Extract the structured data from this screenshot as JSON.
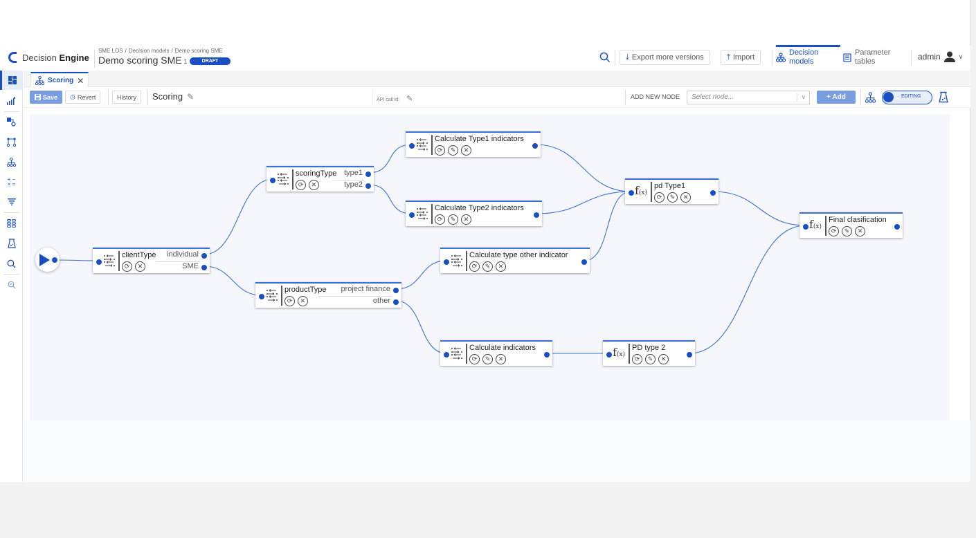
{
  "header": {
    "brand_light": "Decision ",
    "brand_bold": "Engine",
    "breadcrumb": [
      "SME LOS",
      "Decision models",
      "Demo scoring SME"
    ],
    "model_title": "Demo scoring SME",
    "version": "1",
    "status_badge": "DRAFT",
    "export_label": "Export more versions",
    "import_label": "Import",
    "nav": [
      {
        "label_1": "Decision",
        "label_2": "models",
        "active": true
      },
      {
        "label_1": "Parameter",
        "label_2": "tables",
        "active": false
      }
    ],
    "user": "admin"
  },
  "sidebar": {
    "items": [
      "dashboard-icon",
      "analytics-icon",
      "node-link-icon",
      "flow-icon",
      "tree-icon",
      "calculator-icon",
      "filter-icon",
      "grid-icon",
      "flask-icon",
      "search-icon",
      "search-history-icon"
    ]
  },
  "tabs": [
    {
      "label": "Scoring",
      "icon": "tree-icon",
      "active": true
    }
  ],
  "toolbar": {
    "save_label": "Save",
    "revert_label": "Revert",
    "history_label": "History",
    "title": "Scoring",
    "api_label": "API call id:",
    "add_node_label": "ADD NEW NODE",
    "select_placeholder": "Select node...",
    "add_label": "+ Add",
    "toggle_label": "EDITING",
    "toggle_on": true
  },
  "flow": {
    "nodes": [
      {
        "id": "clientType",
        "name": "clientType",
        "type": "switch",
        "branches": [
          "individual",
          "SME"
        ],
        "actions": [
          "refresh",
          "delete"
        ]
      },
      {
        "id": "scoringType",
        "name": "scoringType",
        "type": "switch",
        "branches": [
          "type1",
          "type2"
        ],
        "actions": [
          "refresh",
          "delete"
        ]
      },
      {
        "id": "productType",
        "name": "productType",
        "type": "switch",
        "branches": [
          "project finance",
          "other"
        ],
        "actions": [
          "refresh",
          "delete"
        ]
      },
      {
        "id": "calcType1",
        "name": "Calculate Type1 indicators",
        "type": "switch",
        "branches": [],
        "actions": [
          "refresh",
          "edit",
          "delete"
        ]
      },
      {
        "id": "calcType2",
        "name": "Calculate Type2 indicators",
        "type": "switch",
        "branches": [],
        "actions": [
          "refresh",
          "edit",
          "delete"
        ]
      },
      {
        "id": "calcOther",
        "name": "Calculate type other indicator",
        "type": "switch",
        "branches": [],
        "actions": [
          "refresh",
          "edit",
          "delete"
        ]
      },
      {
        "id": "calcInd",
        "name": "Calculate indicators",
        "type": "switch",
        "branches": [],
        "actions": [
          "refresh",
          "edit",
          "delete"
        ]
      },
      {
        "id": "pdType1",
        "name": "pd Type1",
        "type": "function",
        "branches": [],
        "actions": [
          "refresh",
          "edit",
          "delete"
        ]
      },
      {
        "id": "pdType2",
        "name": "PD type 2",
        "type": "function",
        "branches": [],
        "actions": [
          "refresh",
          "edit",
          "delete"
        ]
      },
      {
        "id": "final",
        "name": "Final clasification",
        "type": "function",
        "branches": [],
        "actions": [
          "refresh",
          "edit",
          "delete"
        ]
      }
    ],
    "fx_label": "f",
    "fx_sub": "(x)"
  }
}
